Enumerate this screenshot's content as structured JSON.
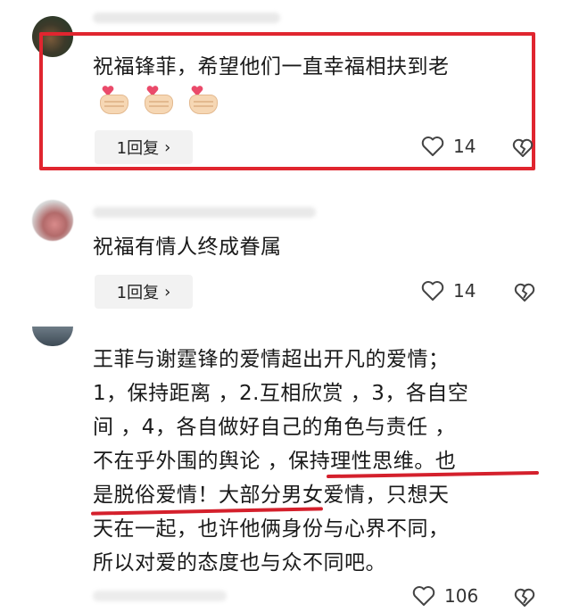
{
  "comments": [
    {
      "text": "祝福锋菲，希望他们一直幸福相扶到老",
      "emojis": [
        "hand-heart",
        "hand-heart",
        "hand-heart"
      ],
      "reply_label": "1回复",
      "reply_chevron": "›",
      "likes": "14",
      "highlighted": true
    },
    {
      "text": "祝福有情人终成眷属",
      "reply_label": "1回复",
      "reply_chevron": "›",
      "likes": "14"
    },
    {
      "lines": [
        "王菲与谢霆锋的爱情超出开凡的爱情；",
        "1，保持距离 ，2.互相欣赏 ，3，各自空",
        "间 ，4，各自做好自己的角色与责任 ，",
        "不在乎外围的舆论 ，保持理性思维。也",
        "是脱俗爱情！大部分男女爱情，只想天",
        "天在一起，也许他俩身份与心界不同，",
        "所以对爱的态度也与众不同吧。"
      ],
      "likes": "106"
    }
  ],
  "colors": {
    "highlight_red": "#e0252f",
    "underline_red": "#d4202c",
    "reply_bg": "#f2f2f2"
  }
}
